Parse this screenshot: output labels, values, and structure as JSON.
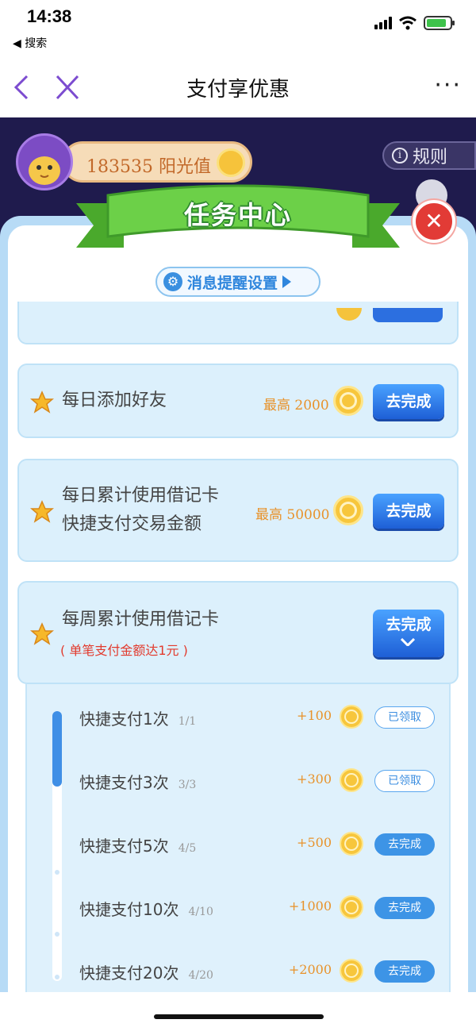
{
  "status_bar": {
    "time": "14:38",
    "back_label": "◀ 搜索"
  },
  "nav": {
    "title": "支付享优惠",
    "more": "···"
  },
  "header": {
    "sunshine_value": "183535 阳光值",
    "rules_label": "规则",
    "rules_icon": "info-icon"
  },
  "panel": {
    "title": "任务中心",
    "message_settings": "消息提醒设置"
  },
  "tasks": [
    {
      "title_lines": [
        "每日添加好友"
      ],
      "reward": "最高 2000",
      "button": "去完成"
    },
    {
      "title_lines": [
        "每日累计使用借记卡",
        "快捷支付交易金额"
      ],
      "reward": "最高 50000",
      "button": "去完成"
    },
    {
      "title_lines": [
        "每周累计使用借记卡"
      ],
      "note": "( 单笔支付金额达1元 )",
      "button": "去完成",
      "expanded": true
    }
  ],
  "subtasks": [
    {
      "name": "快捷支付1次",
      "progress": "1/1",
      "reward": "+100",
      "button": "已领取",
      "claimed": true
    },
    {
      "name": "快捷支付3次",
      "progress": "3/3",
      "reward": "+300",
      "button": "已领取",
      "claimed": true
    },
    {
      "name": "快捷支付5次",
      "progress": "4/5",
      "reward": "+500",
      "button": "去完成",
      "claimed": false
    },
    {
      "name": "快捷支付10次",
      "progress": "4/10",
      "reward": "+1000",
      "button": "去完成",
      "claimed": false
    },
    {
      "name": "快捷支付20次",
      "progress": "4/20",
      "reward": "+2000",
      "button": "去完成",
      "claimed": false
    }
  ],
  "subtask_progress_fraction": 0.28,
  "colors": {
    "accent": "#2c6fe0",
    "reward": "#e8922a",
    "header_bg": "#1f1b4d",
    "ribbon": "#5bc23e",
    "close": "#e23b36"
  }
}
